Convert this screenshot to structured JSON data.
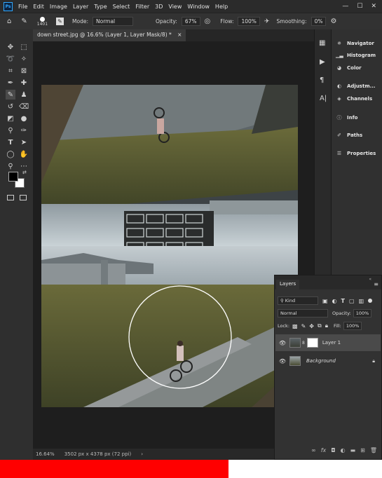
{
  "app": {
    "logo": "Ps"
  },
  "menu": [
    "File",
    "Edit",
    "Image",
    "Layer",
    "Type",
    "Select",
    "Filter",
    "3D",
    "View",
    "Window",
    "Help"
  ],
  "window_controls": [
    "—",
    "☐",
    "✕"
  ],
  "options": {
    "brush_size": "1401",
    "mode_label": "Mode:",
    "mode_value": "Normal",
    "opacity_label": "Opacity:",
    "opacity_value": "67%",
    "flow_label": "Flow:",
    "flow_value": "100%",
    "smoothing_label": "Smoothing:",
    "smoothing_value": "0%"
  },
  "document": {
    "tab_title": "down street.jpg @ 16.6% (Layer 1, Layer Mask/8) *"
  },
  "status": {
    "zoom": "16.64%",
    "dimensions": "3502 px x 4378 px (72 ppi)"
  },
  "right_panel": {
    "items": [
      "Navigator",
      "Histogram",
      "Color",
      "Adjustm...",
      "Channels",
      "Info",
      "Paths",
      "Properties"
    ]
  },
  "layers_panel": {
    "tab": "Layers",
    "filter_kind": "Kind",
    "blend_mode": "Normal",
    "opacity_label": "Opacity:",
    "opacity_value": "100%",
    "lock_label": "Lock:",
    "fill_label": "Fill:",
    "fill_value": "100%",
    "layers": [
      {
        "name": "Layer 1",
        "active": true
      },
      {
        "name": "Background",
        "active": false
      }
    ]
  },
  "colors": {
    "foreground": "#000000",
    "background": "#ffffff",
    "video_progress": "#ff0000"
  },
  "video": {
    "progress": 0.6
  }
}
